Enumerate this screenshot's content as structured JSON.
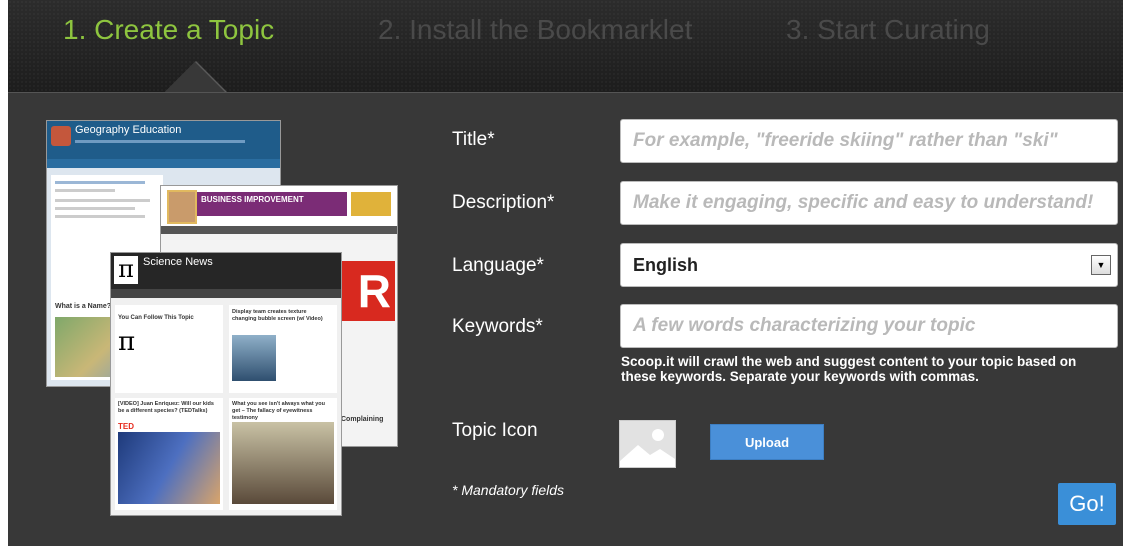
{
  "steps": [
    {
      "label": "1. Create a Topic",
      "active": true
    },
    {
      "label": "2. Install the Bookmarklet",
      "active": false
    },
    {
      "label": "3. Start Curating",
      "active": false
    }
  ],
  "preview": {
    "card1_title": "Geography Education",
    "card2_title": "BUSINESS IMPROVEMENT",
    "card3_title": "Science News",
    "pi_glyph": "π",
    "card3_post1": "You Can Follow This Topic",
    "card3_post2": "Display team creates texture changing bubble screen (w/ Video)",
    "card3_post3": "[VIDEO] Juan Enriquez: Will our kids be a different species? (TEDTalks)",
    "card3_post4": "What you see isn't always what you get – The fallacy of eyewitness testimony",
    "ted_text": "TED",
    "card1_side": "What is a Name?",
    "card2_post": "Complaining",
    "card2_letter": "R"
  },
  "form": {
    "title_label": "Title*",
    "title_placeholder": "For example, \"freeride skiing\" rather than \"ski\"",
    "description_label": "Description*",
    "description_placeholder": "Make it engaging, specific and easy to understand!",
    "language_label": "Language*",
    "language_value": "English",
    "keywords_label": "Keywords*",
    "keywords_placeholder": "A few words characterizing your topic",
    "keywords_help": "Scoop.it will crawl the web and suggest content to your topic based on these keywords. Separate your keywords with commas.",
    "topic_icon_label": "Topic Icon",
    "upload_label": "Upload",
    "mandatory_note": "* Mandatory fields",
    "go_label": "Go!"
  },
  "colors": {
    "active_step": "#8ec53f",
    "inactive_step": "#4a4a4a",
    "panel_bg": "#383838",
    "button_blue": "#4a90d9"
  }
}
